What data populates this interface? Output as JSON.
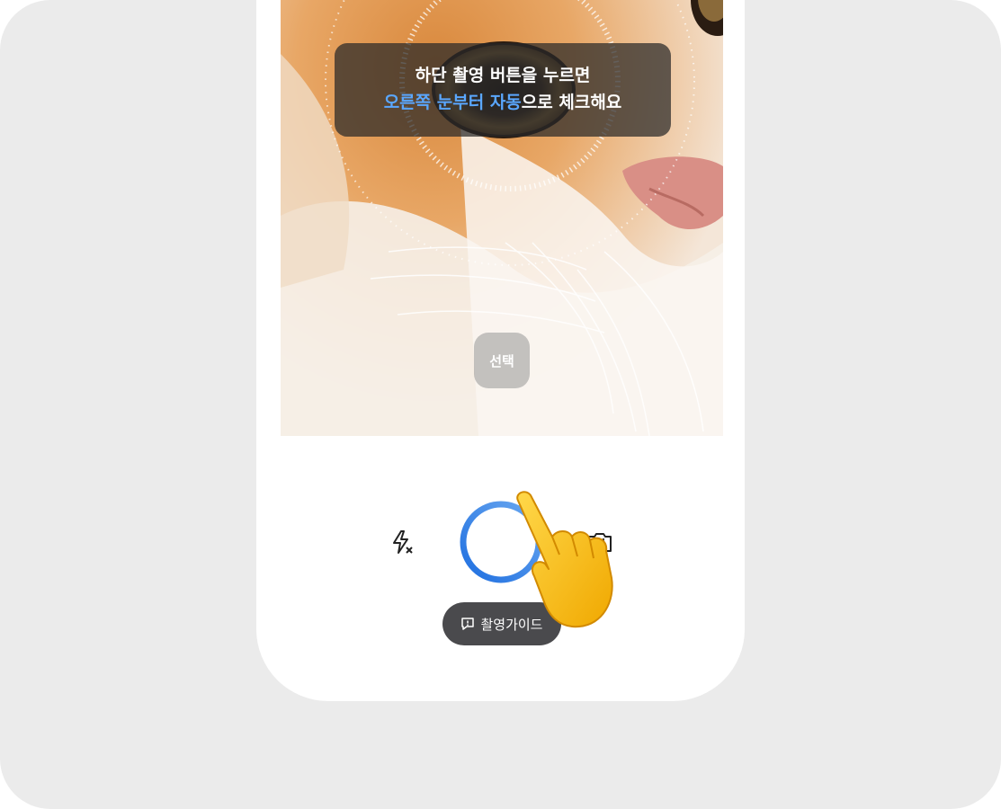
{
  "camera": {
    "guide_line1": "하단 촬영 버튼을 누르면",
    "guide_line2_highlight1": "오른쪽 눈부터",
    "guide_line2_highlight2": "자동",
    "guide_line2_rest": "으로 체크해요",
    "select_label": "선택"
  },
  "controls": {
    "flash_icon": "flash-off-icon",
    "shutter_icon": "shutter-ring",
    "switch_icon": "camera-switch-icon",
    "guide_label": "촬영가이드",
    "guide_icon": "speech-bubble-alert-icon"
  },
  "colors": {
    "background": "#ebebeb",
    "accent": "#2f80e8",
    "highlight_text": "#5aa7ff",
    "pill_bg": "#4a4a4d"
  }
}
